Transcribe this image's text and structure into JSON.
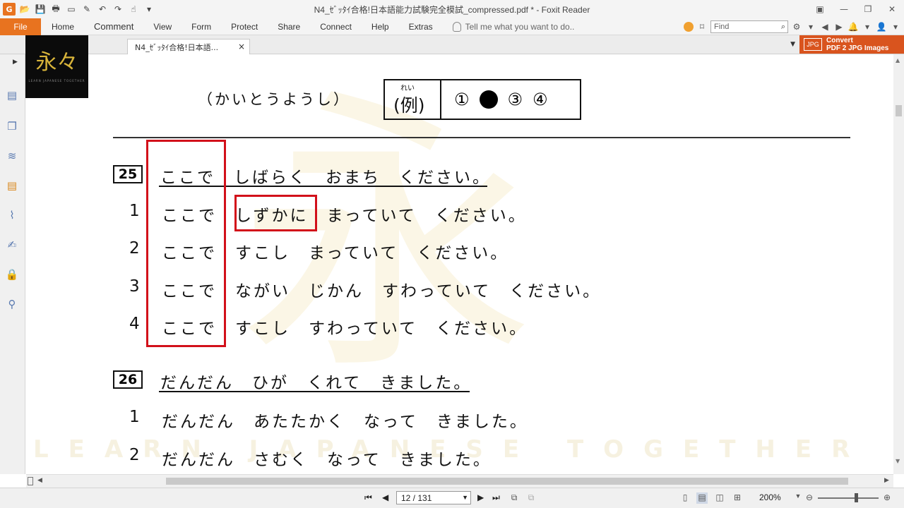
{
  "window": {
    "title": "N4_ｾﾞｯﾀｲ合格!日本語能力試験完全模試_compressed.pdf * - Foxit Reader",
    "controls": [
      "▣",
      "—",
      "❐",
      "✕"
    ]
  },
  "quick_access": [
    "G",
    "📂",
    "💾",
    "🖶",
    "▭",
    "✎",
    "↶",
    "↷",
    "☝",
    "▾"
  ],
  "ribbon": {
    "file_label": "File",
    "tabs": [
      "Home",
      "Comment",
      "View",
      "Form",
      "Protect",
      "Share",
      "Connect",
      "Help",
      "Extras"
    ],
    "tell_me": "Tell me what you want to do..",
    "find_placeholder": "Find",
    "find_icon": "⌕",
    "right_icons": [
      "⚙",
      "▾",
      "◀",
      "▶",
      "🔔",
      "▾",
      "👤",
      "▾"
    ]
  },
  "doc_tab": {
    "label": "N4_ｾﾞｯﾀｲ合格!日本語...",
    "close": "×"
  },
  "convert": {
    "icon_text": "JPG",
    "line1": "Convert",
    "line2": "PDF 2 JPG Images"
  },
  "logo": {
    "kanji": "永々",
    "subtitle": "LEARN JAPANESE TOGETHER"
  },
  "document": {
    "watermark_kanji": "永",
    "watermark_text": "LEARN JAPANESE TOGETHER",
    "answer_sheet_label": "（かいとうようし）",
    "example": {
      "furigana": "れい",
      "label": "(例)",
      "options": [
        "①",
        "③",
        "④"
      ]
    },
    "questions": [
      {
        "number": "25",
        "sentence": "ここで　しばらく　おまち　ください。",
        "options": [
          {
            "num": "1",
            "text": "ここで　しずかに　まっていて　ください。"
          },
          {
            "num": "2",
            "text": "ここで　すこし　まっていて　ください。"
          },
          {
            "num": "3",
            "text": "ここで　ながい　じかん　すわっていて　ください。"
          },
          {
            "num": "4",
            "text": "ここで　すこし　すわっていて　ください。"
          }
        ]
      },
      {
        "number": "26",
        "sentence": "だんだん　ひが　くれて　きました。",
        "options": [
          {
            "num": "1",
            "text": "だんだん　あたたかく　なって　きました。"
          },
          {
            "num": "2",
            "text": "だんだん　さむく　なって　きました。"
          }
        ]
      }
    ]
  },
  "status": {
    "first": "⏮",
    "prev": "◀",
    "page": "12 / 131",
    "next": "▶",
    "last": "⏭",
    "zoom": "200%",
    "zoom_out": "⊖",
    "zoom_in": "⊕"
  }
}
